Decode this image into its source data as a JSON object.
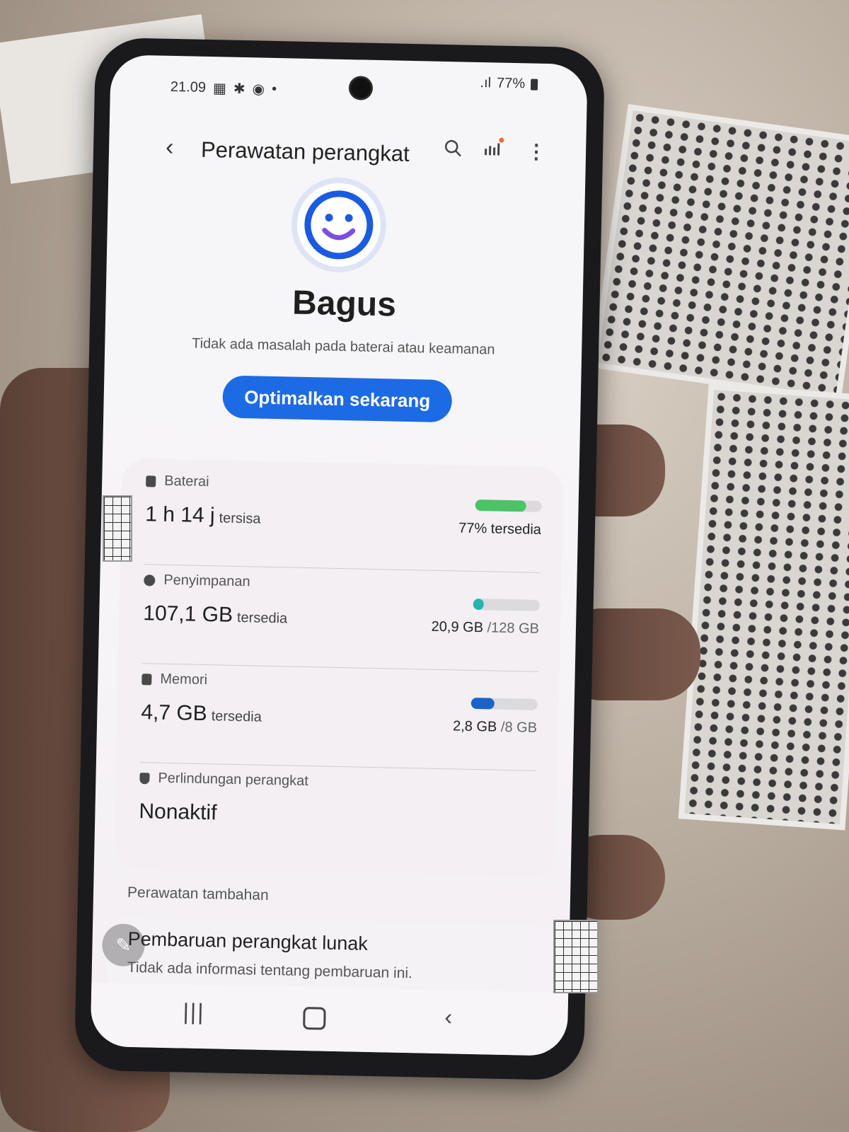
{
  "status_bar": {
    "time": "21.09",
    "battery_percent": "77%"
  },
  "header": {
    "title": "Perawatan perangkat",
    "icons": [
      "back-icon",
      "search-icon",
      "chart-icon",
      "more-icon"
    ]
  },
  "summary": {
    "status": "Bagus",
    "description": "Tidak ada masalah pada baterai atau keamanan",
    "button_label": "Optimalkan sekarang"
  },
  "metrics": {
    "battery": {
      "label": "Baterai",
      "value": "1 h 14 j",
      "unit": "tersisa",
      "right_text": "77% tersedia",
      "level": 0.77,
      "color": "#4cc365"
    },
    "storage": {
      "label": "Penyimpanan",
      "value": "107,1 GB",
      "unit": "tersedia",
      "used": "20,9 GB",
      "total": "/128 GB",
      "level": 0.163,
      "color": "#25b5b0"
    },
    "memory": {
      "label": "Memori",
      "value": "4,7 GB",
      "unit": "tersedia",
      "used": "2,8 GB",
      "total": "/8 GB",
      "level": 0.35,
      "color": "#1a63c9"
    },
    "protection": {
      "label": "Perlindungan perangkat",
      "value": "Nonaktif"
    }
  },
  "extra": {
    "section_label": "Perawatan tambahan",
    "update_title": "Pembaruan perangkat lunak",
    "update_subtitle": "Tidak ada informasi tentang pembaruan ini."
  },
  "colors": {
    "accent": "#1d6ae5"
  }
}
